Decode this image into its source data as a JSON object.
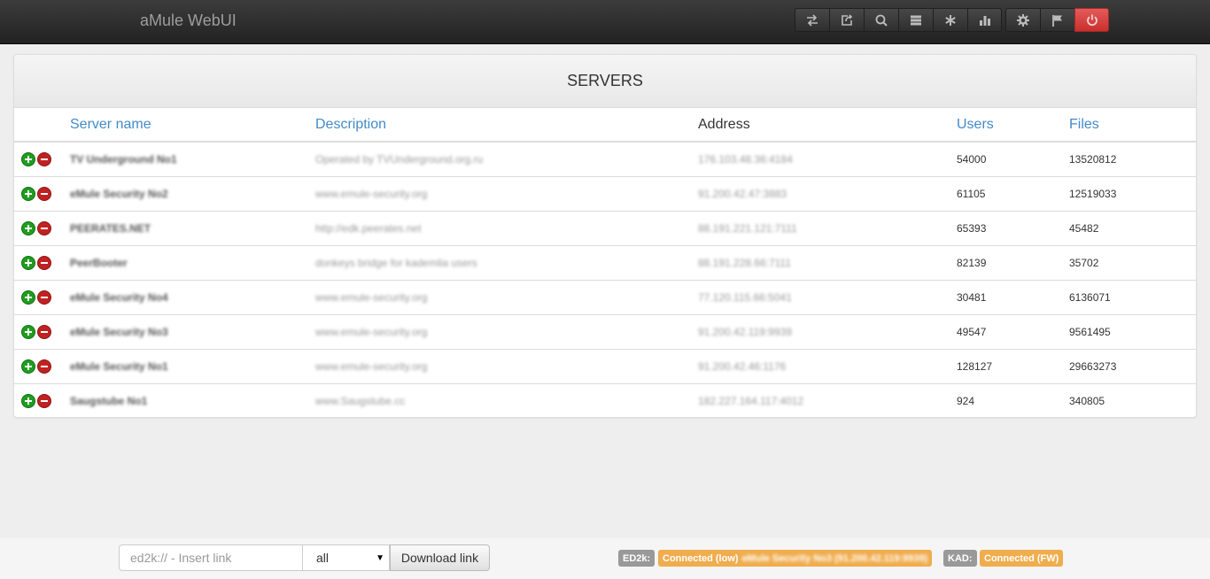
{
  "app": {
    "title": "aMule WebUI"
  },
  "toolbar": {
    "groups": [
      [
        {
          "icon": "transfers-icon"
        },
        {
          "icon": "shared-icon"
        },
        {
          "icon": "search-icon"
        },
        {
          "icon": "servers-icon"
        },
        {
          "icon": "kad-icon"
        },
        {
          "icon": "stats-icon"
        }
      ],
      [
        {
          "icon": "gear-icon"
        },
        {
          "icon": "flag-icon"
        },
        {
          "icon": "power-icon"
        }
      ]
    ]
  },
  "panel": {
    "title": "SERVERS"
  },
  "table": {
    "headers": {
      "name": "Server name",
      "description": "Description",
      "address": "Address",
      "users": "Users",
      "files": "Files"
    },
    "rows": [
      {
        "name": "TV Underground No1",
        "description": "Operated by TVUnderground.org.ru",
        "address": "176.103.48.36:4184",
        "users": "54000",
        "files": "13520812"
      },
      {
        "name": "eMule Security No2",
        "description": "www.emule-security.org",
        "address": "91.200.42.47:3883",
        "users": "61105",
        "files": "12519033"
      },
      {
        "name": "PEERATES.NET",
        "description": "http://edk.peerates.net",
        "address": "88.191.221.121:7111",
        "users": "65393",
        "files": "45482"
      },
      {
        "name": "PeerBooter",
        "description": "donkeys bridge for kademlia users",
        "address": "88.191.228.66:7111",
        "users": "82139",
        "files": "35702"
      },
      {
        "name": "eMule Security No4",
        "description": "www.emule-security.org",
        "address": "77.120.115.66:5041",
        "users": "30481",
        "files": "6136071"
      },
      {
        "name": "eMule Security No3",
        "description": "www.emule-security.org",
        "address": "91.200.42.119:9939",
        "users": "49547",
        "files": "9561495"
      },
      {
        "name": "eMule Security No1",
        "description": "www.emule-security.org",
        "address": "91.200.42.46:1176",
        "users": "128127",
        "files": "29663273"
      },
      {
        "name": "Saugstube No1",
        "description": "www.Saugstube.cc",
        "address": "182.227.164.117:4012",
        "users": "924",
        "files": "340805"
      }
    ]
  },
  "footer": {
    "link_placeholder": "ed2k:// - Insert link",
    "category_selected": "all",
    "download_label": "Download link",
    "ed2k_label": "ED2k:",
    "ed2k_status": "Connected (low)",
    "ed2k_server": "eMule Security No3 (91.200.42.119:9939)",
    "kad_label": "KAD:",
    "kad_status": "Connected (FW)"
  },
  "colors": {
    "link": "#428bca",
    "danger": "#d9534f",
    "warning": "#f0ad4e",
    "label_default": "#999999",
    "add": "#1f9d1f",
    "remove": "#c12121"
  }
}
